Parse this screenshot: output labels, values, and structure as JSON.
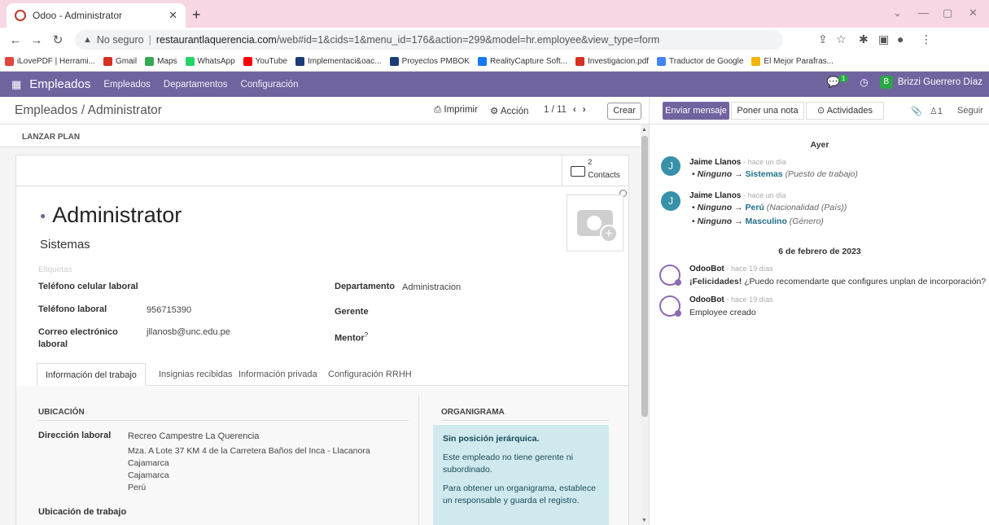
{
  "browser": {
    "tab_title": "Odoo - Administrator",
    "url_warning": "No seguro",
    "url_host": "restaurantlaquerencia.com",
    "url_path": "/web#id=1&cids=1&menu_id=176&action=299&model=hr.employee&view_type=form",
    "bookmarks": [
      {
        "label": "iLovePDF | Herrami...",
        "color": "#e2453c"
      },
      {
        "label": "Gmail",
        "color": "#d93025"
      },
      {
        "label": "Maps",
        "color": "#34a853"
      },
      {
        "label": "WhatsApp",
        "color": "#25d366"
      },
      {
        "label": "YouTube",
        "color": "#ff0000"
      },
      {
        "label": "Implementaci&oac...",
        "color": "#1b3c78"
      },
      {
        "label": "Proyectos PMBOK",
        "color": "#1b3c78"
      },
      {
        "label": "RealityCapture Soft...",
        "color": "#1877f2"
      },
      {
        "label": "Investigacion.pdf",
        "color": "#d93025"
      },
      {
        "label": "Traductor de Google",
        "color": "#4285f4"
      },
      {
        "label": "El Mejor Parafras...",
        "color": "#f4b400"
      }
    ]
  },
  "navbar": {
    "app_name": "Empleados",
    "menu": [
      "Empleados",
      "Departamentos",
      "Configuración"
    ],
    "chat_badge": "1",
    "user_initial": "B",
    "user_name": "Brizzi Guerrero Díaz",
    "bg_color": "#71639e"
  },
  "control": {
    "breadcrumb": "Empleados / Administrator",
    "print": "Imprimir",
    "action": "Acción",
    "pager": "1 / 11",
    "create": "Crear"
  },
  "form": {
    "launch_plan": "LANZAR PLAN",
    "contacts_count": "2",
    "contacts_label": "Contacts",
    "name": "Administrator",
    "job_title": "Sistemas",
    "tags_placeholder": "Etiquetas",
    "fields": {
      "mobile_label": "Teléfono celular laboral",
      "mobile_value": "",
      "phone_label": "Teléfono laboral",
      "phone_value": "956715390",
      "email_label": "Correo electrónico laboral",
      "email_value": "jllanosb@unc.edu.pe",
      "department_label": "Departamento",
      "department_value": "Administracion",
      "manager_label": "Gerente",
      "manager_value": "",
      "mentor_label": "Mentor",
      "mentor_help": "?"
    },
    "tabs": [
      "Información del trabajo",
      "Insignias recibidas",
      "Información privada",
      "Configuración RRHH"
    ],
    "location_section": "UBICACIÓN",
    "work_address_label": "Dirección laboral",
    "work_address_lines": [
      "Recreo Campestre La Querencia",
      "Mza. A Lote 37 KM 4 de la Carretera Baños del Inca - Llacanora",
      "Cajamarca",
      "Cajamarca",
      "Perú"
    ],
    "work_location_label": "Ubicación de trabajo",
    "org_section": "ORGANIGRAMA",
    "org_title": "Sin posición jerárquica.",
    "org_p1": "Este empleado no tiene gerente ni subordinado.",
    "org_p2": "Para obtener un organigrama, establece un responsable y guarda el registro."
  },
  "chatter": {
    "send_message": "Enviar mensaje",
    "log_note": "Poner una nota",
    "activities": "Actividades",
    "followers_count": "1",
    "follow": "Seguir",
    "date1": "Ayer",
    "date2": "6 de febrero de 2023",
    "messages": [
      {
        "author": "Jaime Llanos",
        "time": "- hace un día",
        "initial": "J",
        "changes": [
          {
            "old": "Ninguno",
            "new": "Sistemas",
            "field": "(Puesto de trabajo)"
          }
        ]
      },
      {
        "author": "Jaime Llanos",
        "time": "- hace un día",
        "initial": "J",
        "changes": [
          {
            "old": "Ninguno",
            "new": "Perú",
            "field": "(Nacionalidad (País))"
          },
          {
            "old": "Ninguno",
            "new": "Masculino",
            "field": "(Género)"
          }
        ]
      },
      {
        "author": "OdooBot",
        "time": "- hace 19 días",
        "body_bold": "¡Felicidades!",
        "body": " ¿Puedo recomendarte que configures unplan de incorporación?"
      },
      {
        "author": "OdooBot",
        "time": "- hace 19 días",
        "body": "Employee creado"
      }
    ]
  }
}
